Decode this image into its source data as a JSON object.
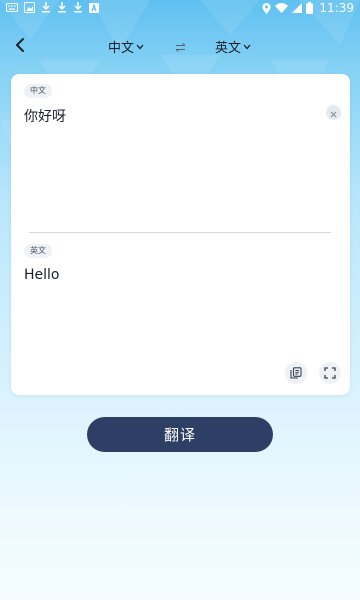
{
  "status_bar": {
    "time": "11:39",
    "left_icons": [
      "keyboard-icon",
      "image-icon",
      "download-icon",
      "download-icon",
      "download-icon",
      "text-a-icon"
    ],
    "right_icons": [
      "location-icon",
      "wifi-icon",
      "signal-icon",
      "battery-icon"
    ]
  },
  "nav": {
    "back_icon": "chevron-left-icon",
    "source_language": "中文",
    "target_language": "英文",
    "swap_icon": "swap-icon"
  },
  "source_panel": {
    "tag": "中文",
    "text": "你好呀",
    "clear_icon": "close-icon"
  },
  "target_panel": {
    "tag": "英文",
    "text": "Hello",
    "copy_icon": "copy-icon",
    "fullscreen_icon": "fullscreen-icon"
  },
  "actions": {
    "translate_label": "翻译"
  },
  "colors": {
    "primary_button": "#2e3f66",
    "header_blue": "#5fc0f0",
    "card_bg": "#ffffff"
  }
}
